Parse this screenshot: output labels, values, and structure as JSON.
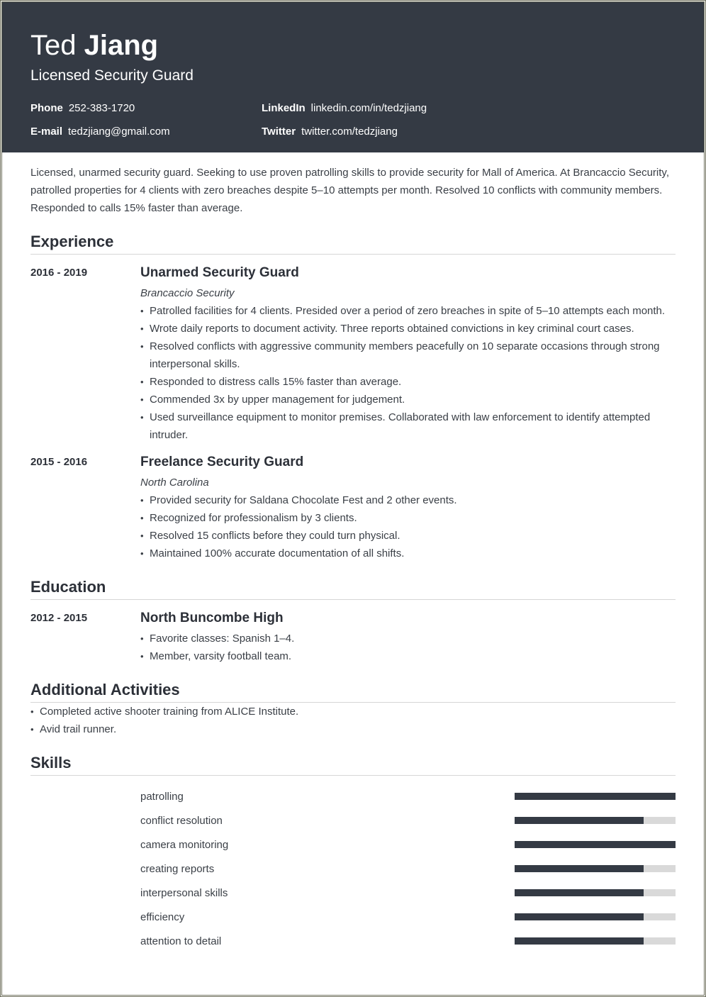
{
  "header": {
    "first_name": "Ted",
    "last_name": "Jiang",
    "title": "Licensed Security Guard",
    "contacts": [
      {
        "label": "Phone",
        "value": "252-383-1720"
      },
      {
        "label": "LinkedIn",
        "value": "linkedin.com/in/tedzjiang"
      },
      {
        "label": "E-mail",
        "value": "tedzjiang@gmail.com"
      },
      {
        "label": "Twitter",
        "value": "twitter.com/tedzjiang"
      }
    ]
  },
  "summary": "Licensed, unarmed security guard. Seeking to use proven patrolling skills to provide security for Mall of America. At Brancaccio Security, patrolled properties for 4 clients with zero breaches despite 5–10 attempts per month. Resolved 10 conflicts with community members. Responded to calls 15% faster than average.",
  "experience": {
    "title": "Experience",
    "items": [
      {
        "dates": "2016 - 2019",
        "role": "Unarmed Security Guard",
        "org": "Brancaccio Security",
        "bullets": [
          "Patrolled facilities for 4 clients. Presided over a period of zero breaches in spite of 5–10 attempts each month.",
          "Wrote daily reports to document activity. Three reports obtained convictions in key criminal court cases.",
          "Resolved conflicts with aggressive community members peacefully on 10 separate occasions through strong interpersonal skills.",
          "Responded to distress calls 15% faster than average.",
          "Commended 3x by upper management for judgement.",
          "Used surveillance equipment to monitor premises. Collaborated with law enforcement to identify attempted intruder."
        ]
      },
      {
        "dates": "2015 - 2016",
        "role": "Freelance Security Guard",
        "org": "North Carolina",
        "bullets": [
          "Provided security for Saldana Chocolate Fest and 2 other events.",
          "Recognized for professionalism by 3 clients.",
          "Resolved 15 conflicts before they could turn physical.",
          "Maintained 100% accurate documentation of all shifts."
        ]
      }
    ]
  },
  "education": {
    "title": "Education",
    "items": [
      {
        "dates": "2012 - 2015",
        "school": "North Buncombe High",
        "bullets": [
          "Favorite classes: Spanish 1–4.",
          "Member, varsity football team."
        ]
      }
    ]
  },
  "activities": {
    "title": "Additional Activities",
    "bullets": [
      "Completed active shooter training from ALICE Institute.",
      "Avid trail runner."
    ]
  },
  "skills": {
    "title": "Skills",
    "items": [
      {
        "name": "patrolling",
        "level": 1.0
      },
      {
        "name": "conflict resolution",
        "level": 0.8
      },
      {
        "name": "camera monitoring",
        "level": 1.0
      },
      {
        "name": "creating reports",
        "level": 0.8
      },
      {
        "name": "interpersonal skills",
        "level": 0.8
      },
      {
        "name": "efficiency",
        "level": 0.8
      },
      {
        "name": "attention to detail",
        "level": 0.8
      }
    ]
  },
  "colors": {
    "header_bg": "#343a44",
    "bar_fill": "#343a44",
    "bar_track": "#d9d9d9"
  }
}
